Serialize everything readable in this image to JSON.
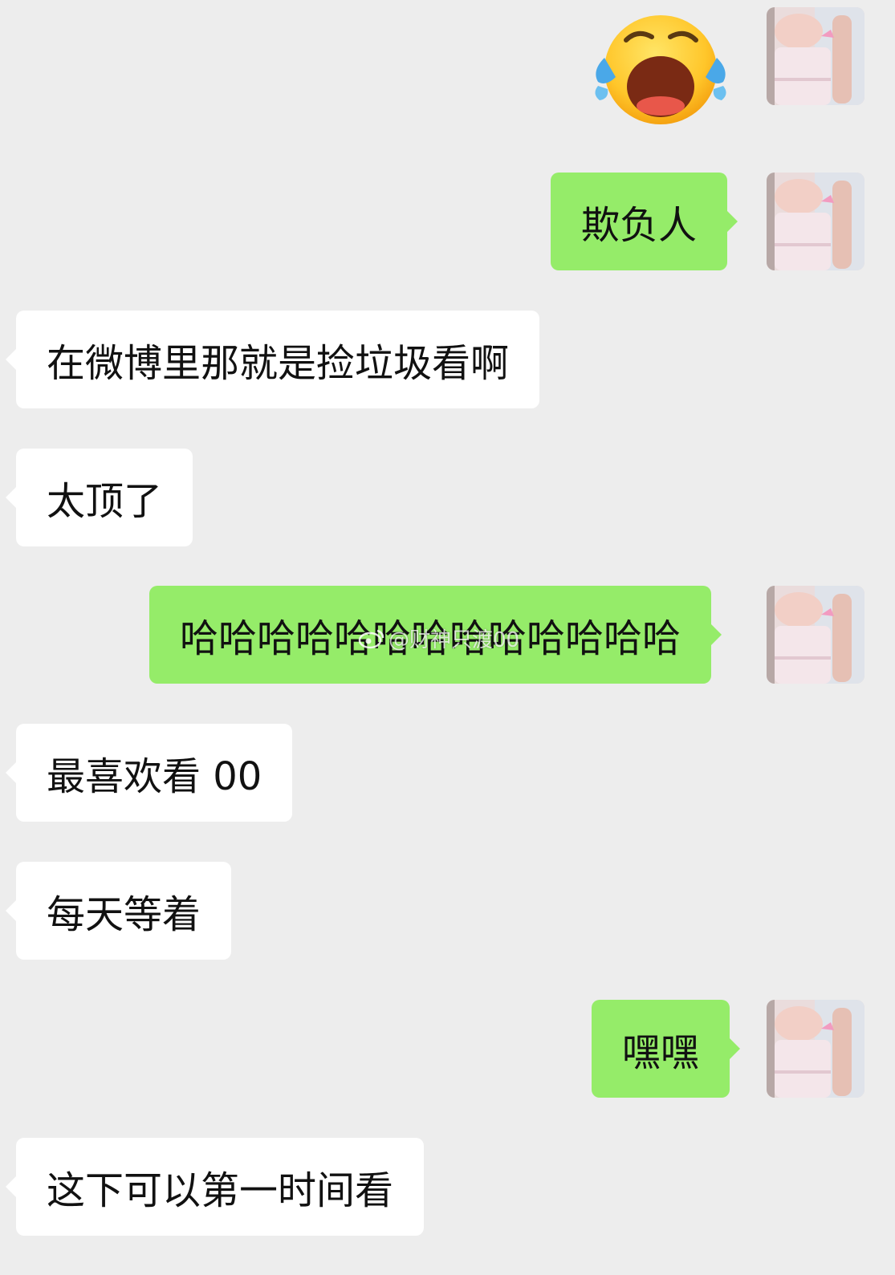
{
  "messages": [
    {
      "side": "right",
      "type": "sticker",
      "sticker": "crying-face-emoji"
    },
    {
      "side": "right",
      "type": "text",
      "text": "欺负人"
    },
    {
      "side": "left",
      "type": "text",
      "text": "在微博里那就是捡垃圾看啊"
    },
    {
      "side": "left",
      "type": "text",
      "text": "太顶了"
    },
    {
      "side": "right",
      "type": "text",
      "text": "哈哈哈哈哈哈哈哈哈哈哈哈哈"
    },
    {
      "side": "left",
      "type": "text",
      "text": "最喜欢看 00"
    },
    {
      "side": "left",
      "type": "text",
      "text": "每天等着"
    },
    {
      "side": "right",
      "type": "text",
      "text": "嘿嘿"
    },
    {
      "side": "left",
      "type": "text",
      "text": "这下可以第一时间看"
    }
  ],
  "watermark": {
    "text": "@财神只渡00",
    "icon": "weibo-logo-icon"
  },
  "colors": {
    "background": "#ededed",
    "right_bubble": "#95ec69",
    "left_bubble": "#ffffff",
    "text": "#111111"
  }
}
